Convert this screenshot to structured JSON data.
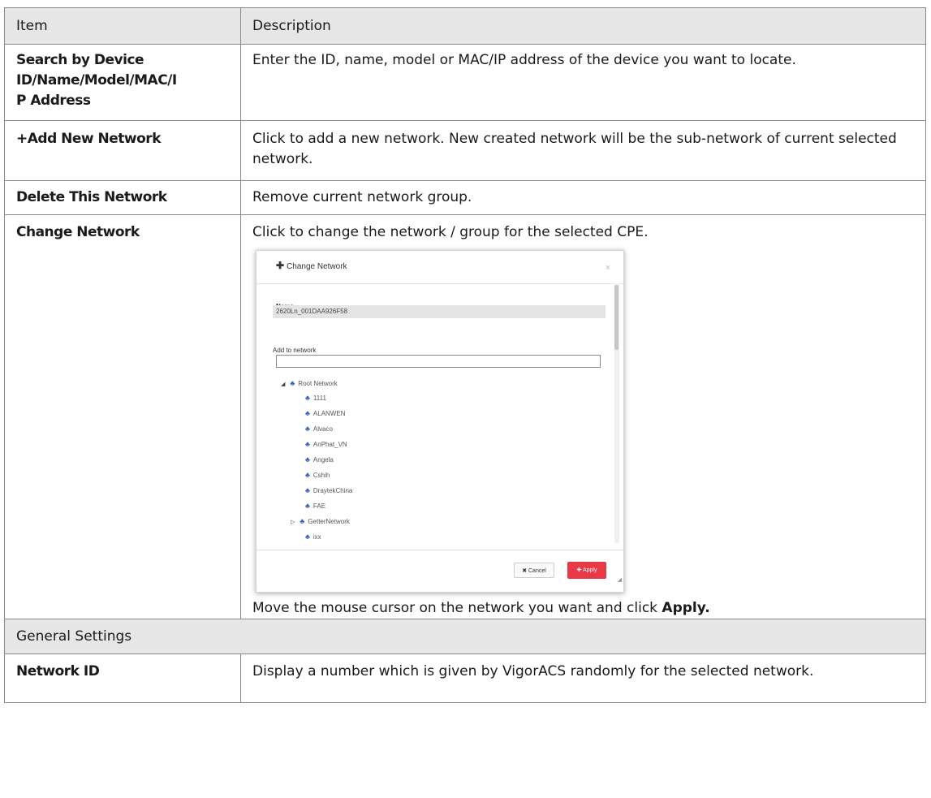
{
  "table": {
    "header": {
      "item": "Item",
      "description": "Description"
    },
    "rows": [
      {
        "item": "Search by Device ID/Name/Model/MAC/IP Address",
        "item_lines": [
          "Search by Device",
          "ID/Name/Model/MAC/I",
          "P Address"
        ],
        "description": "Enter the ID, name, model or MAC/IP address of the device you want to locate."
      },
      {
        "item": "+Add New Network",
        "description": "Click to add a new network. New created network will be the sub-network of current selected network."
      },
      {
        "item": "Delete This Network",
        "description": "Remove current network group."
      },
      {
        "item": "Change Network",
        "description": "Click to change the network / group for the selected CPE.",
        "note_prefix": "Move the mouse cursor on the network you want and click ",
        "note_bold": "Apply."
      }
    ],
    "section": "General Settings",
    "rows2": [
      {
        "item": "Network ID",
        "description": "Display a number which is given by VigorACS randomly for the selected network."
      }
    ]
  },
  "dialog": {
    "title": "Change Network",
    "title_icon": "plus-icon",
    "close": "×",
    "name_label": "Name",
    "name_value": "2620Ln_001DAA926F58",
    "add_label": "Add to network",
    "search_value": "",
    "tree": {
      "root": "Root Network",
      "children": [
        "1111",
        "ALANWEN",
        "Alvaco",
        "AnPhat_VN",
        "Angela",
        "Cshih",
        "DraytekChina",
        "FAE",
        "GetterNetwork",
        "ixx"
      ]
    },
    "cancel": "Cancel",
    "apply": "Apply",
    "cancel_icon": "x-icon",
    "apply_icon": "plus-icon"
  }
}
